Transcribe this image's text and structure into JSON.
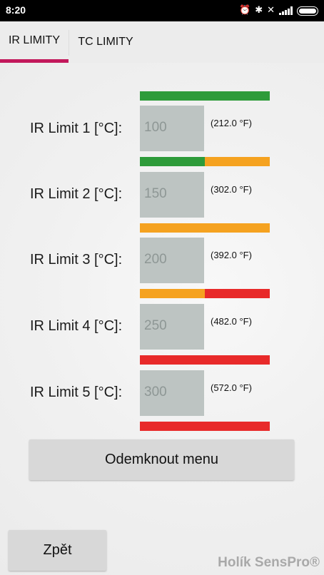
{
  "status_bar": {
    "time": "8:20",
    "icons": [
      "alarm-icon",
      "bluetooth-icon",
      "vibrate-icon",
      "signal-icon",
      "battery-icon"
    ]
  },
  "tabs": [
    {
      "label": "IR LIMITY",
      "active": true
    },
    {
      "label": "TC LIMITY",
      "active": false
    }
  ],
  "accent_color": "#c2185b",
  "colors": {
    "green": "#2e9b3a",
    "orange": "#f5a220",
    "red": "#e82a2a"
  },
  "limit_bars": [
    [
      "green"
    ],
    [
      "green",
      "orange"
    ],
    [
      "orange"
    ],
    [
      "orange",
      "red"
    ],
    [
      "red"
    ],
    [
      "red"
    ]
  ],
  "limits": [
    {
      "label": "IR Limit 1 [°C]:",
      "placeholder": "100",
      "fahrenheit": "(212.0 °F)"
    },
    {
      "label": "IR Limit 2 [°C]:",
      "placeholder": "150",
      "fahrenheit": "(302.0 °F)"
    },
    {
      "label": "IR Limit 3 [°C]:",
      "placeholder": "200",
      "fahrenheit": "(392.0 °F)"
    },
    {
      "label": "IR Limit 4 [°C]:",
      "placeholder": "250",
      "fahrenheit": "(482.0 °F)"
    },
    {
      "label": "IR Limit 5 [°C]:",
      "placeholder": "300",
      "fahrenheit": "(572.0 °F)"
    }
  ],
  "unlock_button": "Odemknout menu",
  "back_button": "Zpět",
  "brand": "Holík SensPro®"
}
